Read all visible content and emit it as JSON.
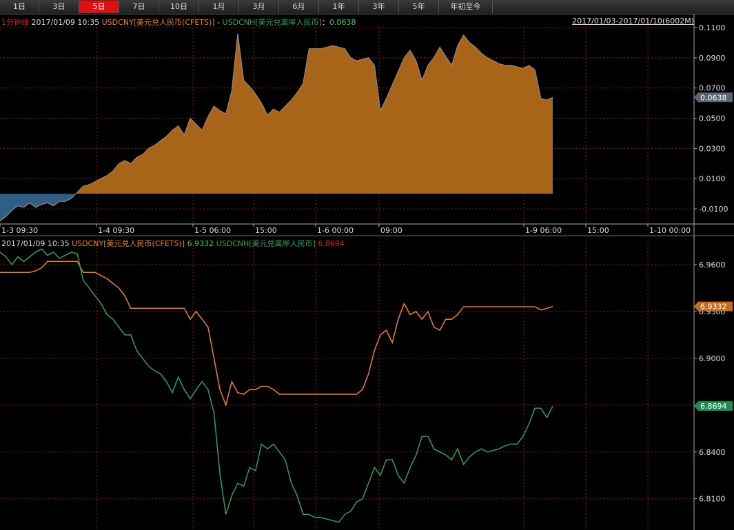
{
  "tabs": [
    {
      "label": "1日",
      "active": false
    },
    {
      "label": "3日",
      "active": false
    },
    {
      "label": "5日",
      "active": true
    },
    {
      "label": "7日",
      "active": false
    },
    {
      "label": "10日",
      "active": false
    },
    {
      "label": "1月",
      "active": false
    },
    {
      "label": "3月",
      "active": false
    },
    {
      "label": "6月",
      "active": false
    },
    {
      "label": "1年",
      "active": false
    },
    {
      "label": "3年",
      "active": false
    },
    {
      "label": "5年",
      "active": false
    },
    {
      "label": "年初至今",
      "active": false
    }
  ],
  "top_panel": {
    "period": "1分钟线",
    "datetime": "2017/01/09 10:35",
    "series_a": "USDCNY[美元兑人民币(CFETS)]",
    "separator": " - ",
    "series_b": "USDCNH[美元兑离岸人民币]",
    "colon": "：",
    "value": "0.0638",
    "range": "2017/01/03-2017/01/10(6002M)",
    "current_tag": "0.0638"
  },
  "bottom_panel": {
    "datetime": "2017/01/09 10:35",
    "series_a": "USDCNY[美元兑人民币(CFETS)]",
    "value_a": "6.9332",
    "series_b": "USDCNH[美元兑离岸人民币]",
    "value_b": "6.8694",
    "tag_a": "6.9332",
    "tag_b": "6.8694"
  },
  "x_axis_labels": [
    "1-3 09:30",
    "1-4 09:30",
    "1-5 06:00",
    "15:00",
    "1-6 00:00",
    "09:00",
    "1-9 06:00",
    "15:00",
    "1-10 00:00"
  ],
  "colors": {
    "usdcny": "#e8842c",
    "usdcnh": "#2aa066",
    "area_pos": "#a8651a",
    "area_neg": "#2f5f86",
    "grid": "#8a1a1a",
    "active_tab": "#e01010"
  },
  "chart_data": [
    {
      "type": "area",
      "title": "USDCNY[美元兑人民币(CFETS)] - USDCNH[美元兑离岸人民币]",
      "ylim": [
        -0.02,
        0.11
      ],
      "yticks": [
        -0.01,
        0.01,
        0.03,
        0.05,
        0.07,
        0.09,
        0.11
      ],
      "ytick_labels": [
        "-0.0100",
        "0.0100",
        "0.0300",
        "0.0500",
        "0.0700",
        "0.0900",
        "0.1100"
      ],
      "x_labels": [
        "1-3 09:30",
        "1-4 09:30",
        "1-5 06:00",
        "15:00",
        "1-6 00:00",
        "09:00",
        "1-9 06:00",
        "15:00",
        "1-10 00:00"
      ],
      "series": [
        {
          "name": "USDCNY - USDCNH",
          "values": [
            -0.018,
            -0.015,
            -0.011,
            -0.008,
            -0.009,
            -0.006,
            -0.009,
            -0.007,
            -0.006,
            -0.008,
            -0.005,
            -0.005,
            -0.003,
            0.001,
            0.005,
            0.006,
            0.008,
            0.01,
            0.012,
            0.015,
            0.02,
            0.022,
            0.02,
            0.024,
            0.026,
            0.03,
            0.032,
            0.035,
            0.038,
            0.042,
            0.045,
            0.039,
            0.05,
            0.046,
            0.042,
            0.051,
            0.058,
            0.055,
            0.053,
            0.068,
            0.106,
            0.075,
            0.071,
            0.066,
            0.06,
            0.052,
            0.056,
            0.054,
            0.058,
            0.062,
            0.067,
            0.073,
            0.096,
            0.096,
            0.096,
            0.097,
            0.098,
            0.097,
            0.096,
            0.09,
            0.088,
            0.089,
            0.09,
            0.085,
            0.055,
            0.063,
            0.072,
            0.081,
            0.09,
            0.095,
            0.088,
            0.075,
            0.085,
            0.09,
            0.097,
            0.091,
            0.085,
            0.098,
            0.105,
            0.1,
            0.097,
            0.093,
            0.09,
            0.088,
            0.086,
            0.085,
            0.085,
            0.084,
            0.083,
            0.085,
            0.082,
            0.063,
            0.062,
            0.0638
          ]
        }
      ]
    },
    {
      "type": "line",
      "ylim": [
        6.79,
        6.975
      ],
      "yticks": [
        6.81,
        6.84,
        6.87,
        6.9,
        6.93,
        6.96
      ],
      "ytick_labels": [
        "6.8100",
        "6.8400",
        "6.8700",
        "6.9000",
        "6.9300",
        "6.9600"
      ],
      "series": [
        {
          "name": "USDCNY[美元兑人民币(CFETS)]",
          "values": [
            6.955,
            6.955,
            6.955,
            6.955,
            6.955,
            6.955,
            6.956,
            6.958,
            6.962,
            6.962,
            6.962,
            6.962,
            6.962,
            6.962,
            6.955,
            6.955,
            6.955,
            6.953,
            6.951,
            6.948,
            6.945,
            6.94,
            6.932,
            6.932,
            6.932,
            6.932,
            6.932,
            6.932,
            6.932,
            6.932,
            6.932,
            6.932,
            6.925,
            6.93,
            6.925,
            6.92,
            6.9,
            6.88,
            6.87,
            6.885,
            6.878,
            6.877,
            6.88,
            6.88,
            6.882,
            6.882,
            6.88,
            6.877,
            6.877,
            6.877,
            6.877,
            6.877,
            6.877,
            6.877,
            6.877,
            6.877,
            6.877,
            6.877,
            6.877,
            6.877,
            6.877,
            6.88,
            6.89,
            6.905,
            6.915,
            6.918,
            6.91,
            6.925,
            6.935,
            6.928,
            6.93,
            6.925,
            6.93,
            6.92,
            6.918,
            6.925,
            6.925,
            6.928,
            6.933,
            6.933,
            6.933,
            6.933,
            6.933,
            6.933,
            6.933,
            6.933,
            6.933,
            6.933,
            6.933,
            6.933,
            6.933,
            6.931,
            6.932,
            6.9332
          ]
        },
        {
          "name": "USDCNH[美元兑离岸人民币]",
          "values": [
            6.968,
            6.965,
            6.96,
            6.965,
            6.962,
            6.965,
            6.968,
            6.97,
            6.966,
            6.968,
            6.964,
            6.966,
            6.968,
            6.967,
            6.95,
            6.945,
            6.94,
            6.935,
            6.928,
            6.925,
            6.92,
            6.915,
            6.915,
            6.905,
            6.9,
            6.895,
            6.892,
            6.89,
            6.885,
            6.878,
            6.888,
            6.88,
            6.874,
            6.88,
            6.885,
            6.88,
            6.865,
            6.826,
            6.8,
            6.812,
            6.82,
            6.818,
            6.83,
            6.828,
            6.845,
            6.842,
            6.845,
            6.84,
            6.835,
            6.82,
            6.812,
            6.8,
            6.8,
            6.798,
            6.798,
            6.797,
            6.796,
            6.795,
            6.8,
            6.802,
            6.808,
            6.81,
            6.82,
            6.83,
            6.825,
            6.835,
            6.835,
            6.825,
            6.82,
            6.83,
            6.838,
            6.85,
            6.85,
            6.842,
            6.84,
            6.838,
            6.835,
            6.842,
            6.832,
            6.837,
            6.84,
            6.842,
            6.84,
            6.841,
            6.842,
            6.844,
            6.845,
            6.845,
            6.85,
            6.858,
            6.868,
            6.868,
            6.862,
            6.8694
          ]
        }
      ]
    }
  ]
}
